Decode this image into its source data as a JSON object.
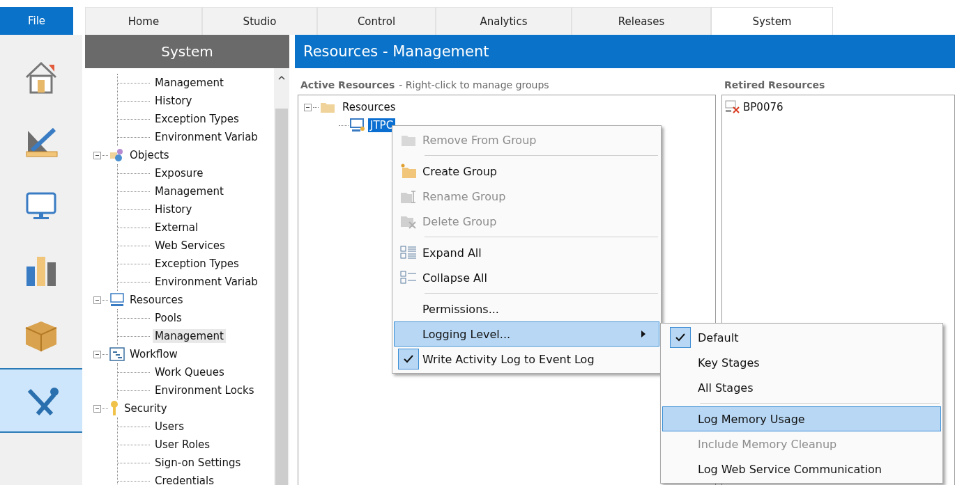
{
  "file_tab": {
    "label": "File"
  },
  "tabs": [
    {
      "label": "Home",
      "selected": false
    },
    {
      "label": "Studio",
      "selected": false
    },
    {
      "label": "Control",
      "selected": false
    },
    {
      "label": "Analytics",
      "selected": false
    },
    {
      "label": "Releases",
      "selected": false
    },
    {
      "label": "System",
      "selected": true
    }
  ],
  "rail": [
    {
      "selected": false
    },
    {
      "selected": false
    },
    {
      "selected": false
    },
    {
      "selected": false
    },
    {
      "selected": false
    },
    {
      "selected": true
    }
  ],
  "sidebar": {
    "title": "System",
    "tree_continued": [
      {
        "label": "Management",
        "selected": false
      },
      {
        "label": "History",
        "selected": false
      },
      {
        "label": "Exception Types",
        "selected": false
      },
      {
        "label": "Environment Variab",
        "selected": false
      }
    ],
    "tree": [
      {
        "label": "Objects",
        "expanded": true,
        "children": [
          {
            "label": "Exposure",
            "selected": false
          },
          {
            "label": "Management",
            "selected": false
          },
          {
            "label": "History",
            "selected": false
          },
          {
            "label": "External",
            "selected": false
          },
          {
            "label": "Web Services",
            "selected": false
          },
          {
            "label": "Exception Types",
            "selected": false
          },
          {
            "label": "Environment Variab",
            "selected": false
          }
        ]
      },
      {
        "label": "Resources",
        "expanded": true,
        "children": [
          {
            "label": "Pools",
            "selected": false
          },
          {
            "label": "Management",
            "selected": true
          }
        ]
      },
      {
        "label": "Workflow",
        "expanded": true,
        "children": [
          {
            "label": "Work Queues",
            "selected": false
          },
          {
            "label": "Environment Locks",
            "selected": false
          }
        ]
      },
      {
        "label": "Security",
        "expanded": true,
        "children": [
          {
            "label": "Users",
            "selected": false
          },
          {
            "label": "User Roles",
            "selected": false
          },
          {
            "label": "Sign-on Settings",
            "selected": false
          },
          {
            "label": "Credentials",
            "selected": false
          }
        ]
      }
    ]
  },
  "page_title": "Resources - Management",
  "active_resources": {
    "heading": "Active Resources",
    "hint": "- Right-click to manage groups",
    "tree": [
      {
        "label": "Resources",
        "expanded": true,
        "children": [
          {
            "label": "JTPC",
            "selected": true
          }
        ]
      }
    ]
  },
  "retired_resources": {
    "heading": "Retired Resources",
    "items": [
      {
        "label": "BP0076"
      }
    ]
  },
  "context_menu": [
    {
      "kind": "item",
      "label": "Remove From Group",
      "disabled": true,
      "checked": false,
      "highlighted": false
    },
    {
      "kind": "separator"
    },
    {
      "kind": "item",
      "label": "Create Group",
      "disabled": false,
      "checked": false,
      "highlighted": false
    },
    {
      "kind": "item",
      "label": "Rename Group",
      "disabled": true,
      "checked": false,
      "highlighted": false
    },
    {
      "kind": "item",
      "label": "Delete Group",
      "disabled": true,
      "checked": false,
      "highlighted": false
    },
    {
      "kind": "separator"
    },
    {
      "kind": "item",
      "label": "Expand All",
      "disabled": false,
      "checked": false,
      "highlighted": false
    },
    {
      "kind": "item",
      "label": "Collapse All",
      "disabled": false,
      "checked": false,
      "highlighted": false
    },
    {
      "kind": "separator"
    },
    {
      "kind": "item",
      "label": "Permissions...",
      "disabled": false,
      "checked": false,
      "highlighted": false
    },
    {
      "kind": "submenu",
      "label": "Logging Level...",
      "disabled": false,
      "checked": false,
      "highlighted": true
    },
    {
      "kind": "item",
      "label": "Write Activity Log to Event Log",
      "disabled": false,
      "checked": true,
      "highlighted": false
    }
  ],
  "submenu": [
    {
      "kind": "item",
      "label": "Default",
      "disabled": false,
      "checked": true,
      "highlighted": false
    },
    {
      "kind": "item",
      "label": "Key Stages",
      "disabled": false,
      "checked": false,
      "highlighted": false
    },
    {
      "kind": "item",
      "label": "All Stages",
      "disabled": false,
      "checked": false,
      "highlighted": false
    },
    {
      "kind": "separator"
    },
    {
      "kind": "item",
      "label": "Log Memory Usage",
      "disabled": false,
      "checked": false,
      "highlighted": true
    },
    {
      "kind": "item",
      "label": "Include Memory Cleanup",
      "disabled": true,
      "checked": false,
      "highlighted": false
    },
    {
      "kind": "item",
      "label": "Log Web Service Communication",
      "disabled": false,
      "checked": false,
      "highlighted": false
    }
  ]
}
